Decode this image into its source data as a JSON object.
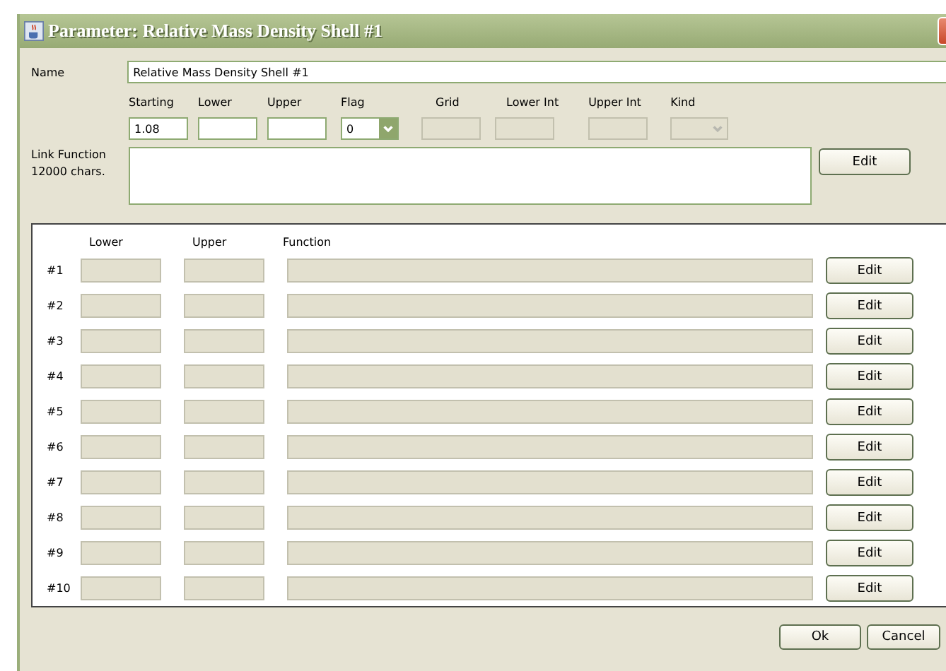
{
  "window": {
    "title": "Parameter:  Relative Mass Density Shell #1"
  },
  "name": {
    "label": "Name",
    "value": "Relative Mass Density Shell #1"
  },
  "params": [
    {
      "label": "Starting",
      "kind": "text",
      "value": "1.08",
      "disabled": false
    },
    {
      "label": "Lower",
      "kind": "text",
      "disabled": false
    },
    {
      "label": "Upper",
      "kind": "text",
      "disabled": false
    },
    {
      "label": "Flag",
      "kind": "combo",
      "value": "0",
      "disabled": false
    },
    {
      "label": "Grid",
      "kind": "text",
      "disabled": true
    },
    {
      "label": "Lower Int",
      "kind": "text",
      "disabled": true
    },
    {
      "label": "Upper Int",
      "kind": "text",
      "disabled": true
    },
    {
      "label": "Kind",
      "kind": "combo",
      "disabled": true
    }
  ],
  "link_function": {
    "label": [
      "Link Function",
      "12000 chars."
    ],
    "edit_button": "Edit"
  },
  "table": {
    "columns": [
      "Lower",
      "Upper",
      "Function"
    ],
    "rows": [
      {
        "label": "#1",
        "button": "Edit"
      },
      {
        "label": "#2",
        "button": "Edit"
      },
      {
        "label": "#3",
        "button": "Edit"
      },
      {
        "label": "#4",
        "button": "Edit"
      },
      {
        "label": "#5",
        "button": "Edit"
      },
      {
        "label": "#6",
        "button": "Edit"
      },
      {
        "label": "#7",
        "button": "Edit"
      },
      {
        "label": "#8",
        "button": "Edit"
      },
      {
        "label": "#9",
        "button": "Edit"
      },
      {
        "label": "#10",
        "button": "Edit"
      }
    ]
  },
  "buttons": [
    "Ok",
    "Cancel"
  ]
}
